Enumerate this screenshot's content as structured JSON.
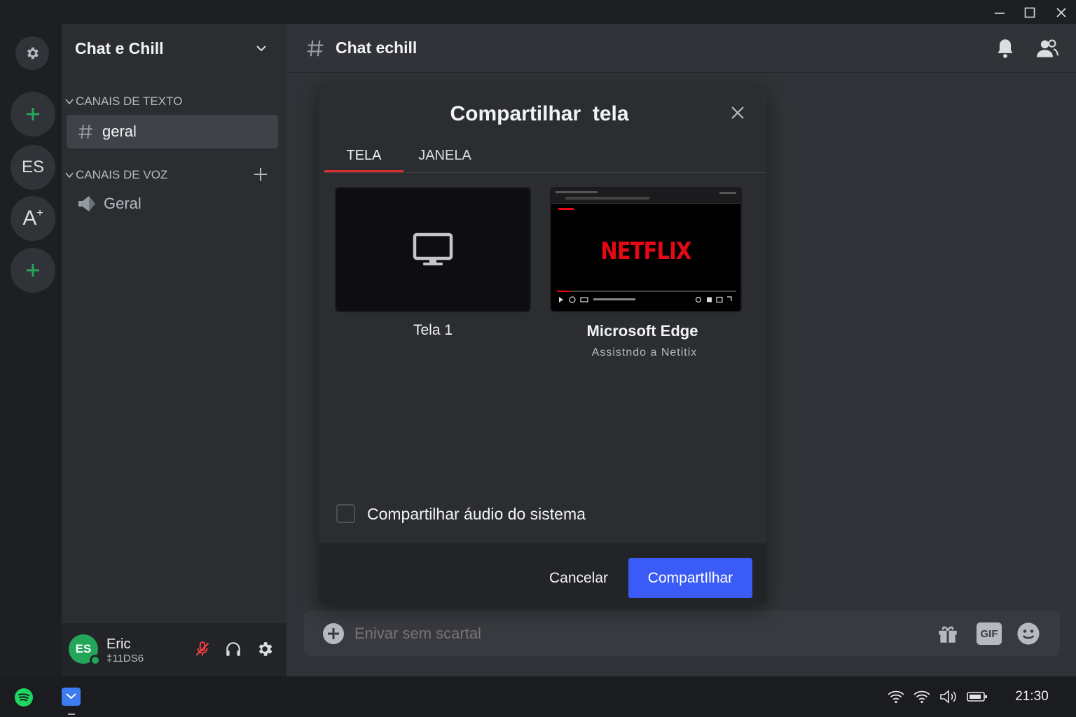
{
  "window_controls": {
    "minimize": "—",
    "maximize": "☐",
    "close": "✕"
  },
  "rail": {
    "es_label": "ES",
    "a_label": "A",
    "a_sup": "+"
  },
  "guild": {
    "name": "Chat e Chill"
  },
  "categories": {
    "text": "CANAIS DE TEXTO",
    "voice": "CANAIS DE VOZ"
  },
  "channels": {
    "text": [
      {
        "name": "geral"
      }
    ],
    "voice": [
      {
        "name": "Geral"
      }
    ]
  },
  "channel_header": {
    "name": "Chat echill"
  },
  "user": {
    "avatar_initials": "ES",
    "name": "Eric",
    "tag": "‡11DS6"
  },
  "composer": {
    "placeholder": "Enivar sem scartal",
    "gif_label": "GIF"
  },
  "modal": {
    "title": "Compartilhar  tela",
    "tabs": [
      {
        "label": "TELA"
      },
      {
        "label": "JANELA"
      }
    ],
    "sources": [
      {
        "title": "Tela 1",
        "subtitle": ""
      },
      {
        "title": "Microsoft Edge",
        "subtitle": "Assistndo a Netitix"
      }
    ],
    "netflix_logo": "NETFLIX",
    "audio_checkbox_label": "Compartilhar áudio do sistema",
    "cancel_label": "Cancelar",
    "share_label": "CompartIlhar"
  },
  "taskbar": {
    "clock": "21:30"
  },
  "colors": {
    "accent": "#3b5bf6",
    "green": "#23a55a",
    "tab_underline": "#da2c2c",
    "netflix_red": "#e50914"
  },
  "icons": [
    "gear-icon",
    "plus-icon",
    "hash-icon",
    "speaker-icon",
    "chevron-down-icon",
    "bell-icon",
    "members-icon",
    "close-icon",
    "monitor-icon",
    "mic-muted-icon",
    "headphones-icon",
    "gift-icon",
    "emoji-icon",
    "spotify-icon",
    "wifi-icon",
    "volume-icon",
    "battery-icon"
  ]
}
